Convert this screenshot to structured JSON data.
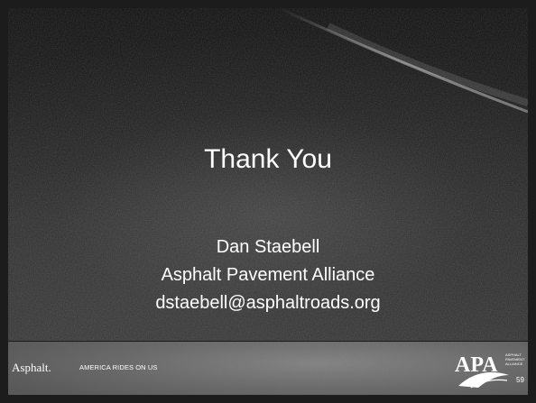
{
  "slide": {
    "title": "Thank You",
    "contact_name": "Dan Staebell",
    "contact_org": "Asphalt Pavement Alliance",
    "contact_email": "dstaebell@asphaltroads.org"
  },
  "footer": {
    "brand": "Asphalt.",
    "tagline": "AMERICA RIDES ON US",
    "logo_text": "APA",
    "logo_subtext_lines": [
      "ASPHALT",
      "PAVEMENT",
      "ALLIANCE"
    ],
    "page_number": "59"
  },
  "colors": {
    "text": "#ffffff",
    "background": "#1c1c1c",
    "footer": "#707070"
  }
}
